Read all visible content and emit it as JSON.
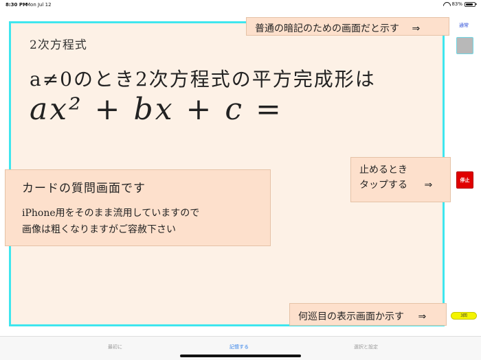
{
  "status_bar": {
    "time": "8:30 PM",
    "date": "Mon Jul 12",
    "battery": "83%",
    "battery_level": 0.83
  },
  "card": {
    "title": "2次方程式",
    "question": "a≠0のとき2次方程式の平方完成形は",
    "formula": "ax² + bx + c ="
  },
  "notes": {
    "normal_mode": "普通の暗記のための画面だと示す",
    "stop_line1": "止めるとき",
    "stop_line2": "タップする",
    "card_heading": "カードの質問画面です",
    "card_line1": "iPhone用をそのまま流用していますので",
    "card_line2": "画像は粗くなりますがご容赦下さい",
    "round_display": "何巡目の表示画面か示す",
    "arrow": "⇒"
  },
  "controls": {
    "normal_label": "通常",
    "stop_label": "停止",
    "round_label": "3回"
  },
  "tabs": [
    {
      "label": "最初に"
    },
    {
      "label": "記憶する"
    },
    {
      "label": "選択と設定"
    }
  ],
  "colors": {
    "card_background": "#fdf1e6",
    "card_border": "#3ee6ee",
    "note_background": "#fde0cc",
    "stop_button": "#e00000",
    "round_badge": "#f4f400",
    "active_tab": "#2c7de8"
  },
  "icons": {
    "wifi": "wifi-icon",
    "battery": "battery-icon"
  }
}
